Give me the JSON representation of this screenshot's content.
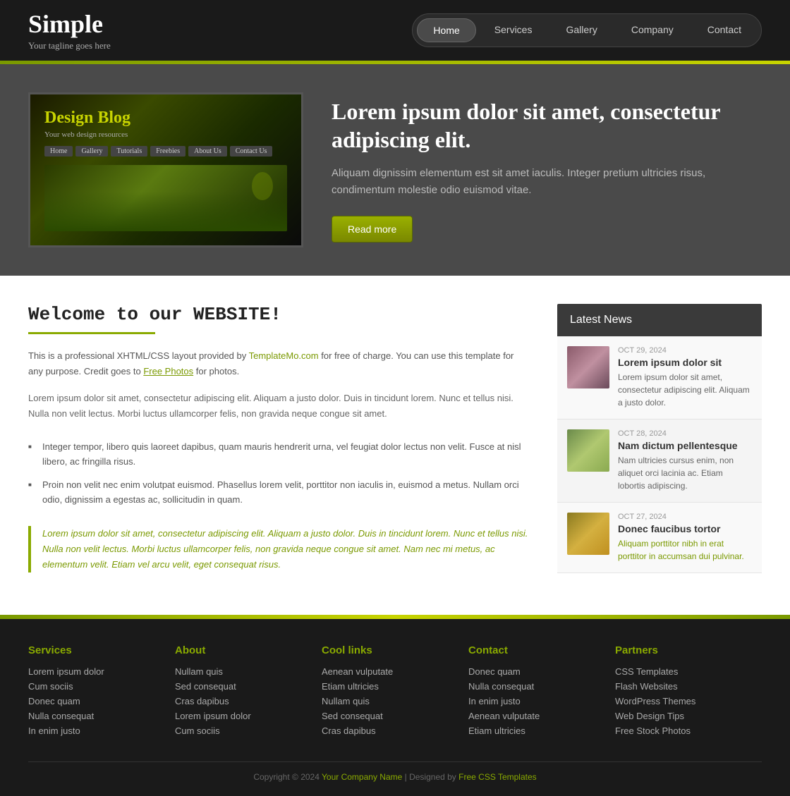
{
  "header": {
    "logo_title": "Simple",
    "logo_tagline": "Your tagline goes here",
    "nav": [
      {
        "label": "Home",
        "active": true
      },
      {
        "label": "Services",
        "active": false
      },
      {
        "label": "Gallery",
        "active": false
      },
      {
        "label": "Company",
        "active": false
      },
      {
        "label": "Contact",
        "active": false
      }
    ]
  },
  "hero": {
    "blog_title": "Design Blog",
    "blog_sub": "Your web design resources",
    "nav_items": [
      "Home",
      "Gallery",
      "Tutorials",
      "Freebies",
      "About Us",
      "Contact Us"
    ],
    "heading": "Lorem ipsum dolor sit amet, consectetur adipiscing elit.",
    "description": "Aliquam dignissim elementum est sit amet iaculis. Integer pretium ultricies risus, condimentum molestie odio euismod vitae.",
    "read_more": "Read more"
  },
  "content": {
    "welcome_title": "Welcome to our WEBSITE!",
    "intro": "This is a professional XHTML/CSS layout provided by TemplateMo.com for free of charge. You can use this template for any purpose. Credit goes to Free Photos for photos.",
    "body": "Lorem ipsum dolor sit amet, consectetur adipiscing elit. Aliquam a justo dolor. Duis in tincidunt lorem. Nunc et tellus nisi. Nulla non velit lectus. Morbi luctus ullamcorper felis, non gravida neque congue sit amet.",
    "bullet1": "Integer tempor, libero quis laoreet dapibus, quam mauris hendrerit urna, vel feugiat dolor lectus non velit. Fusce at nisl libero, ac fringilla risus.",
    "bullet2": "Proin non velit nec enim volutpat euismod. Phasellus lorem velit, porttitor non iaculis in, euismod a metus. Nullam orci odio, dignissim a egestas ac, sollicitudin in quam.",
    "blockquote": "Lorem ipsum dolor sit amet, consectetur adipiscing elit. Aliquam a justo dolor. Duis in tincidunt lorem. Nunc et tellus nisi. Nulla non velit lectus. Morbi luctus ullamcorper felis, non gravida neque congue sit amet. Nam nec mi metus, ac elementum velit. Etiam vel arcu velit, eget consequat risus."
  },
  "sidebar": {
    "title": "Latest News",
    "news": [
      {
        "date": "OCT 29, 2024",
        "title": "Lorem ipsum dolor sit",
        "excerpt": "Lorem ipsum dolor sit amet, consectetur adipiscing elit. Aliquam a justo dolor.",
        "green": false
      },
      {
        "date": "OCT 28, 2024",
        "title": "Nam dictum pellentesque",
        "excerpt": "Nam ultricies cursus enim, non aliquet orci lacinia ac. Etiam lobortis adipiscing.",
        "green": false
      },
      {
        "date": "OCT 27, 2024",
        "title": "Donec faucibus tortor",
        "excerpt": "Aliquam porttitor nibh in erat porttitor in accumsan dui pulvinar.",
        "green": true
      }
    ]
  },
  "footer": {
    "cols": [
      {
        "title": "Services",
        "links": [
          "Lorem ipsum dolor",
          "Cum sociis",
          "Donec quam",
          "Nulla consequat",
          "In enim justo"
        ]
      },
      {
        "title": "About",
        "links": [
          "Nullam quis",
          "Sed consequat",
          "Cras dapibus",
          "Lorem ipsum dolor",
          "Cum sociis"
        ]
      },
      {
        "title": "Cool links",
        "links": [
          "Aenean vulputate",
          "Etiam ultricies",
          "Nullam quis",
          "Sed consequat",
          "Cras dapibus"
        ]
      },
      {
        "title": "Contact",
        "links": [
          "Donec quam",
          "Nulla consequat",
          "In enim justo",
          "Aenean vulputate",
          "Etiam ultricies"
        ]
      },
      {
        "title": "Partners",
        "links": [
          "CSS Templates",
          "Flash Websites",
          "WordPress Themes",
          "Web Design Tips",
          "Free Stock Photos"
        ]
      }
    ],
    "copyright": "Copyright © 2024",
    "company_name": "Your Company Name",
    "designed_by": "Designed by",
    "designer": "Free CSS Templates"
  }
}
